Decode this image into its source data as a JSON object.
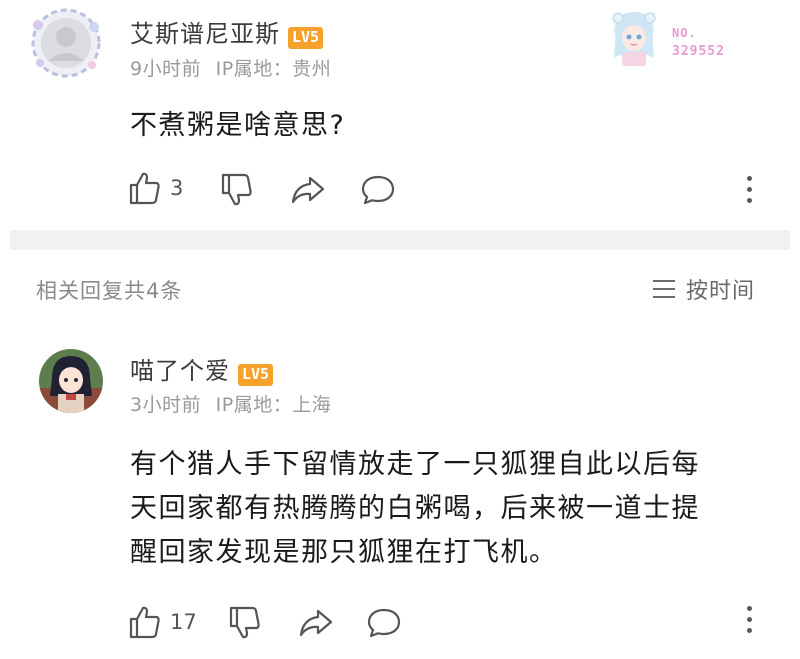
{
  "main_comment": {
    "username": "艾斯谱尼亚斯",
    "level": "LV5",
    "time": "9小时前",
    "ip_label": "IP属地：贵州",
    "content": "不煮粥是啥意思?",
    "likes": "3",
    "badge": {
      "label": "NO.",
      "number": "329552"
    },
    "avatar_icon": "avatar-portrait",
    "badge_icon": "anime-character-badge"
  },
  "replies_header": {
    "title": "相关回复共4条",
    "sort_label": "按时间",
    "sort_icon": "menu-lines-icon"
  },
  "reply": {
    "username": "喵了个爱",
    "level": "LV5",
    "time": "3小时前",
    "ip_label": "IP属地：上海",
    "content_lines": [
      "有个猎人手下留情放走了一只狐狸自此以后每",
      "天回家都有热腾腾的白粥喝，后来被一道士提",
      "醒回家发现是那只狐狸在打飞机。"
    ],
    "likes": "17"
  },
  "colors": {
    "level_badge": "#f6a12b",
    "divider": "#f1f1f1",
    "meta_text": "#9a9a9a",
    "badge_pink": "#e89bd0"
  }
}
